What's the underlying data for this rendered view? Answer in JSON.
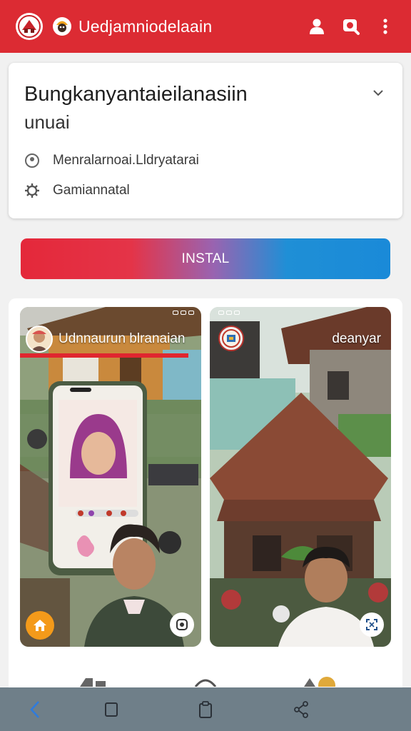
{
  "app_bar": {
    "title": "Uedjamniodelaain",
    "icons": [
      "brand-logo-icon",
      "mascot-logo-icon",
      "profile-icon",
      "search-icon",
      "more-vert-icon"
    ],
    "color": "#dc2b33"
  },
  "info_card": {
    "title": "Bungkanyantaieilanasiin",
    "subtitle": "unuai",
    "location": "Menralarnoai.Lldryatarai",
    "category": "Gamiannatal"
  },
  "install_button": {
    "label": "INSTAL",
    "gradient": [
      "#e4283a",
      "#9a63b0",
      "#1a8ad8"
    ]
  },
  "screenshots": [
    {
      "title": "Udnnaurun blranaian",
      "accent": "#e0262f"
    },
    {
      "title": "deanyar"
    }
  ],
  "nav_bar": {
    "icons": [
      "back-icon",
      "recents-icon",
      "clipboard-icon",
      "share-icon"
    ],
    "color": "#6f7f89"
  }
}
